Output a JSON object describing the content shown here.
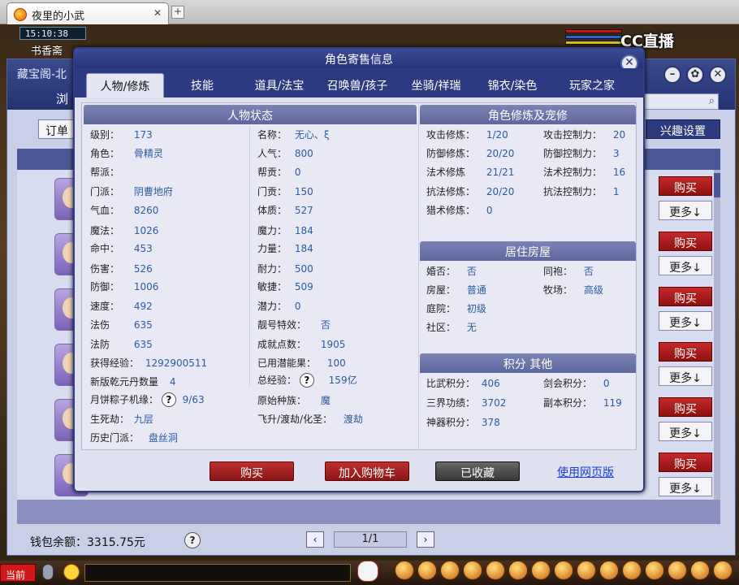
{
  "browser": {
    "tab_title": "夜里的小武",
    "close_glyph": "✕",
    "new_tab_glyph": "+"
  },
  "game": {
    "clock": "15:10:38",
    "location": "书香斋",
    "stream_logo": "CC直播"
  },
  "bg_window": {
    "title": "藏宝阁-北",
    "nav_label": "浏",
    "orders_label": "订单",
    "interest_label": "兴趣设置",
    "buy_label": "购买",
    "more_label": "更多↓",
    "wallet": "钱包余额：3315.75元",
    "page": "1/1",
    "prev": "‹",
    "next": "›",
    "help": "?"
  },
  "taskbar": {
    "current_label": "当前"
  },
  "modal": {
    "title": "角色寄售信息",
    "close": "✕",
    "tabs": [
      "人物/修炼",
      "技能",
      "道具/法宝",
      "召唤兽/孩子",
      "坐骑/祥瑞",
      "锦衣/染色",
      "玩家之家"
    ],
    "status_title": "人物状态",
    "status_left": [
      {
        "label": "级别：",
        "value": "173"
      },
      {
        "label": "角色：",
        "value": "骨精灵"
      },
      {
        "label": "帮派：",
        "value": ""
      },
      {
        "label": "门派：",
        "value": "阴曹地府"
      },
      {
        "label": "气血：",
        "value": "8260"
      },
      {
        "label": "魔法：",
        "value": "1026"
      },
      {
        "label": "命中：",
        "value": "453"
      },
      {
        "label": "伤害：",
        "value": "526"
      },
      {
        "label": "防御：",
        "value": "1006"
      },
      {
        "label": "速度：",
        "value": "492"
      },
      {
        "label": "法伤",
        "value": "635"
      },
      {
        "label": "法防",
        "value": "635"
      }
    ],
    "status_right": [
      {
        "label": "名称：",
        "value": "无心、ξ"
      },
      {
        "label": "人气：",
        "value": "800"
      },
      {
        "label": "帮贡：",
        "value": "0"
      },
      {
        "label": "门贡：",
        "value": "150"
      },
      {
        "label": "体质：",
        "value": "527"
      },
      {
        "label": "魔力：",
        "value": "184"
      },
      {
        "label": "力量：",
        "value": "184"
      },
      {
        "label": "耐力：",
        "value": "500"
      },
      {
        "label": "敏捷：",
        "value": "509"
      },
      {
        "label": "潜力：",
        "value": "0"
      },
      {
        "label": "靓号特效：",
        "value": "否"
      },
      {
        "label": "成就点数：",
        "value": "1905"
      }
    ],
    "extra": {
      "exp_label": "获得经验：",
      "exp_value": "1292900511",
      "used_label": "已用潜能果：",
      "used_value": "100",
      "qianyuan_label": "新版乾元丹数量",
      "qianyuan_value": "4",
      "total_exp_label": "总经验：",
      "total_exp_value": "159亿",
      "mooncake_label": "月饼粽子机缘：",
      "mooncake_value": "9/63",
      "race_label": "原始种族：",
      "race_value": "魔",
      "life_label": "生死劫：",
      "life_value": "九层",
      "ascend_label": "飞升/渡劫/化圣：",
      "ascend_value": "渡劫",
      "history_label": "历史门派：",
      "history_value": "盘丝洞",
      "help": "?"
    },
    "cultivation_title": "角色修炼及宠修",
    "cultivation": [
      {
        "label": "攻击修炼：",
        "value": "1/20",
        "label2": "攻击控制力：",
        "value2": "20"
      },
      {
        "label": "防御修炼：",
        "value": "20/20",
        "label2": "防御控制力：",
        "value2": "3"
      },
      {
        "label": "法术修炼",
        "value": "21/21",
        "label2": "法术控制力：",
        "value2": "16"
      },
      {
        "label": "抗法修炼：",
        "value": "20/20",
        "label2": "抗法控制力：",
        "value2": "1"
      },
      {
        "label": "猎术修炼：",
        "value": "0",
        "label2": "",
        "value2": ""
      }
    ],
    "housing_title": "居住房屋",
    "housing": [
      {
        "label": "婚否：",
        "value": "否",
        "label2": "同袍：",
        "value2": "否"
      },
      {
        "label": "房屋：",
        "value": "普通",
        "label2": "牧场：",
        "value2": "高级"
      },
      {
        "label": "庭院：",
        "value": "初级",
        "label2": "",
        "value2": ""
      },
      {
        "label": "社区：",
        "value": "无",
        "label2": "",
        "value2": ""
      }
    ],
    "points_title": "积分 其他",
    "points": [
      {
        "label": "比武积分：",
        "value": "406",
        "label2": "剑会积分：",
        "value2": "0"
      },
      {
        "label": "三界功绩：",
        "value": "3702",
        "label2": "副本积分：",
        "value2": "119"
      },
      {
        "label": "神器积分：",
        "value": "378",
        "label2": "",
        "value2": ""
      }
    ],
    "buttons": {
      "buy": "购买",
      "add_cart": "加入购物车",
      "collected": "已收藏",
      "web": "使用网页版"
    }
  }
}
